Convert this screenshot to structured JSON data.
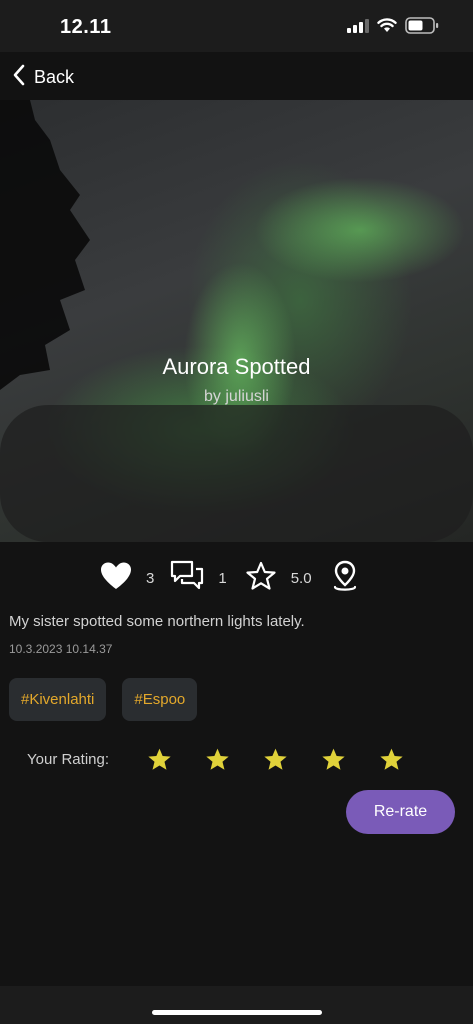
{
  "status_bar": {
    "time": "12.11",
    "icons": [
      "cellular-signal-icon",
      "wifi-icon",
      "battery-icon"
    ]
  },
  "nav": {
    "back_label": "Back",
    "back_icon": "chevron-left-icon"
  },
  "post": {
    "image": "aurora-photo",
    "title": "Aurora Spotted",
    "author": "by juliusli",
    "likes": "3",
    "comments": "1",
    "rating": "5.0",
    "description": "My sister spotted some northern lights lately.",
    "timestamp": "10.3.2023 10.14.37",
    "tags": [
      "#Kivenlahti",
      "#Espoo"
    ]
  },
  "stat_icons": [
    "heart-icon",
    "comments-icon",
    "star-outline-icon",
    "location-pin-icon"
  ],
  "your_rating": {
    "label": "Your Rating:",
    "stars_filled": 5,
    "stars_total": 5
  },
  "rerate_label": "Re-rate",
  "colors": {
    "background": "#131313",
    "tag_text": "#e3a82b",
    "tag_background": "#2a2d30",
    "star_fill": "#e0d23a",
    "button": "#7a5bb8"
  }
}
